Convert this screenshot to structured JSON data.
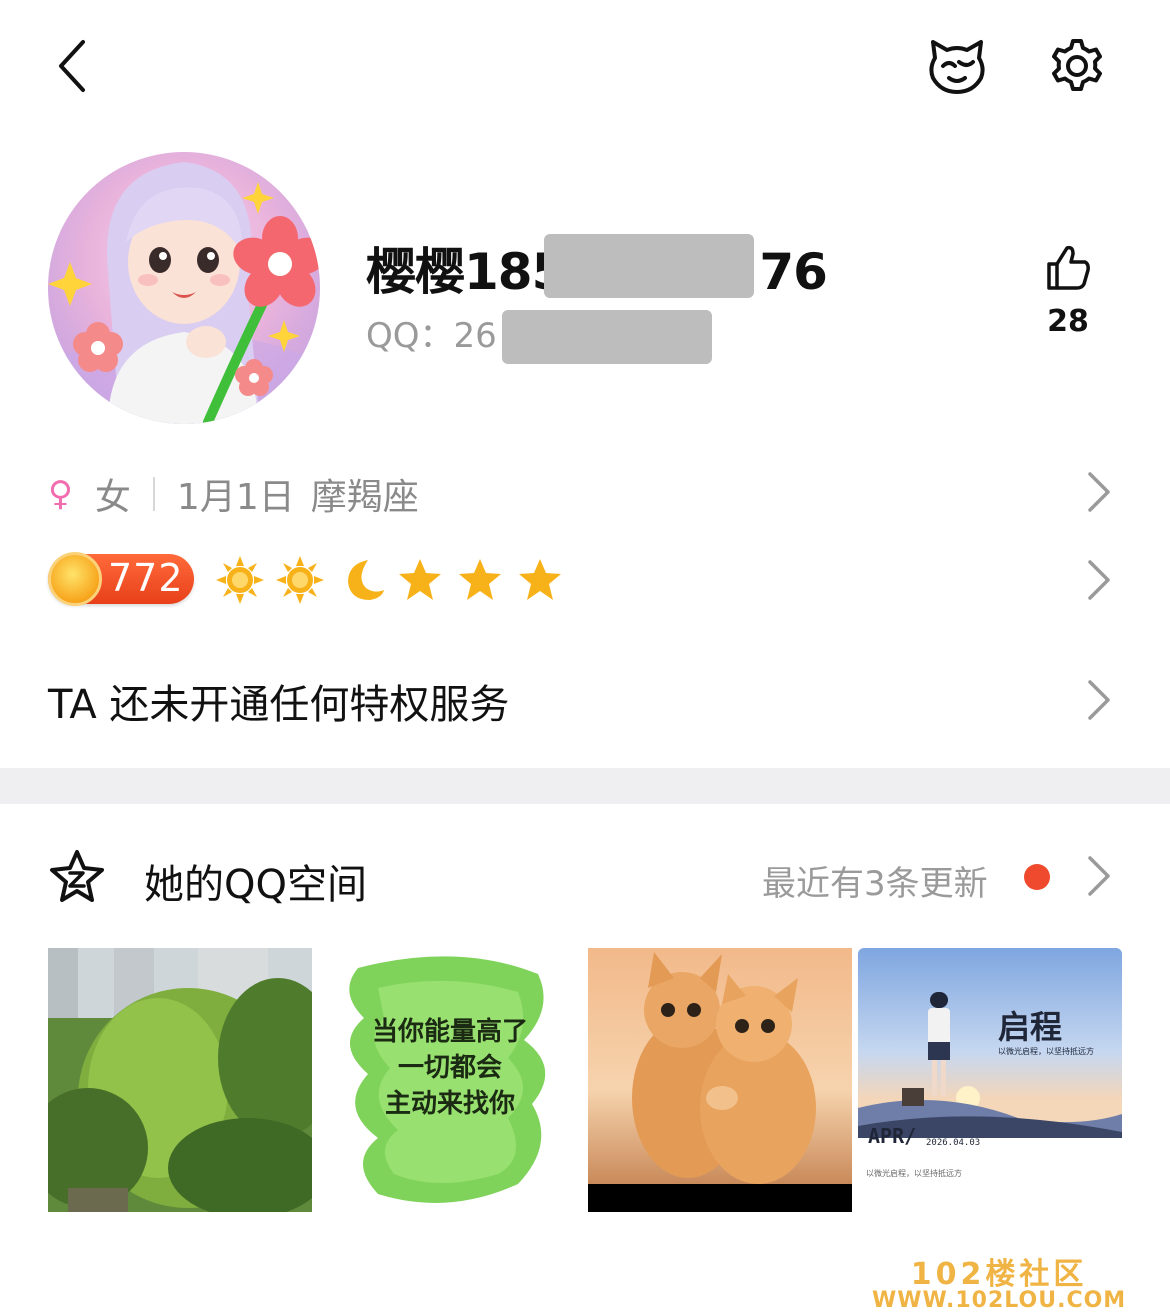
{
  "header": {
    "back_icon": "chevron-left-icon",
    "pet_icon": "cat-face-icon",
    "settings_icon": "gear-icon"
  },
  "profile": {
    "name_prefix": "樱樱185",
    "name_suffix": "76",
    "qq_label": "QQ：",
    "qq_prefix": "26",
    "likes": "28",
    "gender_symbol": "♀",
    "gender": "女",
    "birthday": "1月1日",
    "zodiac": "摩羯座"
  },
  "level": {
    "value": "772",
    "badges": [
      "sun-icon",
      "sun-icon",
      "moon-icon",
      "star-icon",
      "star-icon",
      "star-icon"
    ]
  },
  "privilege": {
    "text": "TA 还未开通任何特权服务"
  },
  "qzone": {
    "title": "她的QQ空间",
    "update_text": "最近有3条更新",
    "photos": [
      {
        "name": "willow-tree-photo"
      },
      {
        "name": "motivational-quote-image",
        "lines": [
          "当你能量高了",
          "一切都会",
          "主动来找你"
        ]
      },
      {
        "name": "kittens-photo"
      },
      {
        "name": "journey-poster-image",
        "title": "启程",
        "subtitle": "以微光启程，以坚持抵远方",
        "month": "APR/",
        "date": "2026.04.03",
        "caption": "以微光启程，以坚持抵远方"
      }
    ]
  },
  "watermark": {
    "line1": "102楼社区",
    "line2": "WWW.102LOU.COM"
  },
  "colors": {
    "accent_red": "#f04a2e",
    "gender_pink": "#f26cb0",
    "badge_orange": "#e8401a"
  }
}
